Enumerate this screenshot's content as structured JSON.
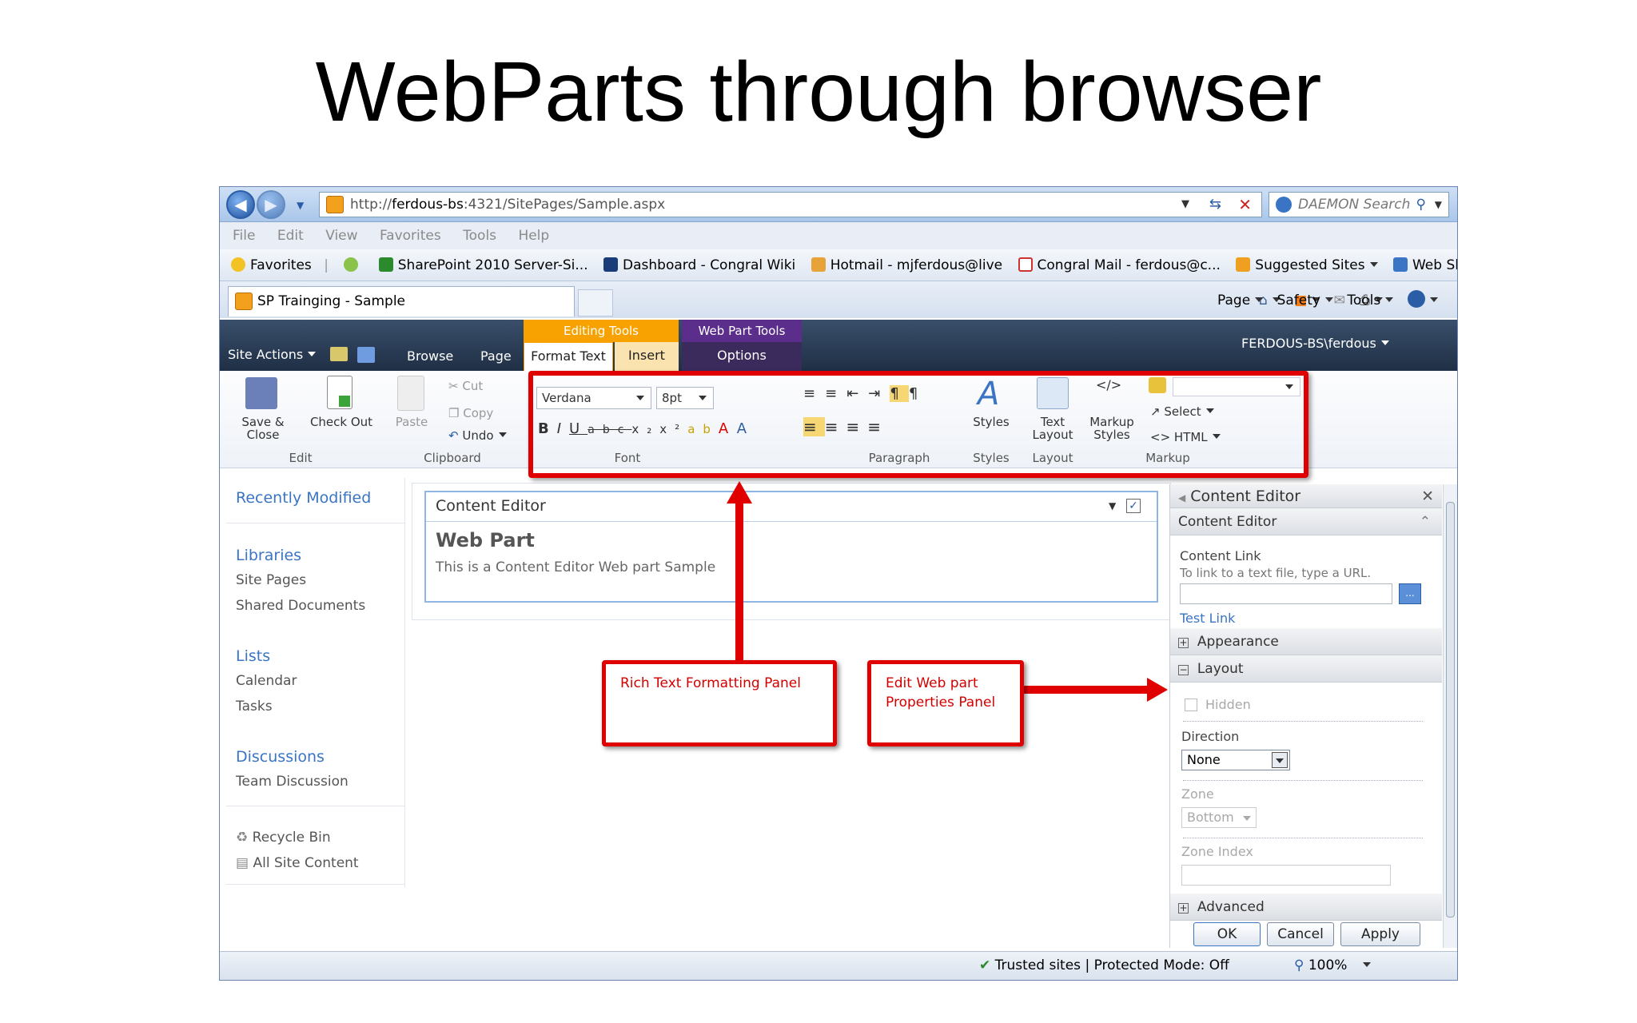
{
  "slide": {
    "title": "WebParts through browser"
  },
  "browser": {
    "address": {
      "prefix": "http://",
      "host": "ferdous-bs",
      "rest": ":4321/SitePages/Sample.aspx"
    },
    "search_placeholder": "DAEMON Search",
    "menu": [
      "File",
      "Edit",
      "View",
      "Favorites",
      "Tools",
      "Help"
    ],
    "favorites_label": "Favorites",
    "favorites": [
      {
        "label": "SharePoint 2010 Server-Si...",
        "color": "#2b8a2b"
      },
      {
        "label": "Dashboard - Congral Wiki",
        "color": "#1a3d7a"
      },
      {
        "label": "Hotmail - mjferdous@live",
        "color": "#e8a23a"
      },
      {
        "label": "Congral Mail - ferdous@c...",
        "color": "#cc3333"
      },
      {
        "label": "Suggested Sites",
        "color": "#f0a020"
      },
      {
        "label": "Web Slice Gallery",
        "color": "#3a74c4"
      }
    ],
    "tab_title": "SP Trainging - Sample",
    "commands": [
      "Page",
      "Safety",
      "Tools"
    ],
    "status": "Trusted sites | Protected Mode: Off",
    "zoom": "100%"
  },
  "ribbon": {
    "site_actions": "Site Actions",
    "tabs": {
      "browse": "Browse",
      "page": "Page",
      "format_text": "Format Text",
      "insert": "Insert",
      "options": "Options"
    },
    "contextual": {
      "editing_tools": "Editing Tools",
      "web_part_tools": "Web Part Tools"
    },
    "user": "FERDOUS-BS\\ferdous",
    "buttons": {
      "save_close": "Save & Close",
      "check_out": "Check Out",
      "paste": "Paste",
      "cut": "Cut",
      "copy": "Copy",
      "undo": "Undo",
      "styles": "Styles",
      "text_layout": "Text Layout",
      "markup_styles": "Markup Styles",
      "select": "Select",
      "html": "HTML"
    },
    "font_name": "Verdana",
    "font_size": "8pt",
    "groups": {
      "edit": "Edit",
      "clipboard": "Clipboard",
      "font": "Font",
      "paragraph": "Paragraph",
      "styles": "Styles",
      "layout": "Layout",
      "markup": "Markup"
    }
  },
  "leftnav": {
    "recently_modified": "Recently Modified",
    "libraries": "Libraries",
    "site_pages": "Site Pages",
    "shared_documents": "Shared Documents",
    "lists": "Lists",
    "calendar": "Calendar",
    "tasks": "Tasks",
    "discussions": "Discussions",
    "team_discussion": "Team Discussion",
    "recycle_bin": "Recycle Bin",
    "all_site_content": "All Site Content"
  },
  "webpart": {
    "title": "Content Editor",
    "heading": "Web Part",
    "body": "This is a Content Editor Web part Sample"
  },
  "panel": {
    "title": "Content Editor",
    "section": "Content Editor",
    "content_link": "Content Link",
    "content_link_help": "To link to a text file, type a URL.",
    "test_link": "Test Link",
    "appearance": "Appearance",
    "layout": "Layout",
    "hidden": "Hidden",
    "direction": "Direction",
    "direction_value": "None",
    "zone": "Zone",
    "zone_value": "Bottom",
    "zone_index": "Zone Index",
    "advanced": "Advanced",
    "ok": "OK",
    "cancel": "Cancel",
    "apply": "Apply"
  },
  "callouts": {
    "rich_text": "Rich Text Formatting Panel",
    "edit_props_line1": "Edit Web part",
    "edit_props_line2": "Properties Panel"
  },
  "colors": {
    "annotation_red": "#e00000",
    "ribbon_dark": "#1f2f45",
    "editing_tools": "#f7a200",
    "web_part_tools": "#5b2e8c",
    "link_blue": "#3a74c4"
  }
}
